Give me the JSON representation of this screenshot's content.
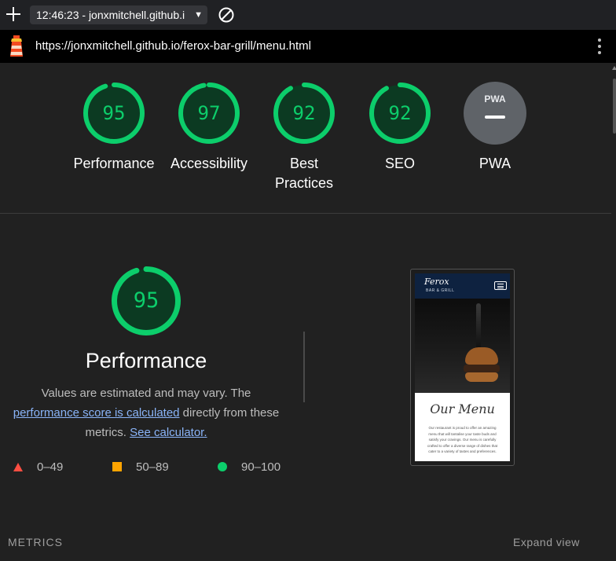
{
  "browser": {
    "tab_title": "12:46:23 - jonxmitchell.github.i",
    "url": "https://jonxmitchell.github.io/ferox-bar-grill/menu.html"
  },
  "scores": [
    {
      "label": "Performance",
      "value": "95",
      "score": 0.95
    },
    {
      "label": "Accessibility",
      "value": "97",
      "score": 0.97
    },
    {
      "label": "Best Practices",
      "value": "92",
      "score": 0.92
    },
    {
      "label": "SEO",
      "value": "92",
      "score": 0.92
    }
  ],
  "pwa": {
    "badge": "PWA",
    "label": "PWA"
  },
  "performance": {
    "score": "95",
    "score_fraction": 0.95,
    "title": "Performance",
    "desc_prefix": "Values are estimated and may vary. The ",
    "desc_link": "performance score is calculated",
    "desc_middle": " directly from these metrics. ",
    "calc_link": "See calculator."
  },
  "legend": [
    {
      "range": "0–49",
      "shape": "triangle",
      "color": "#ff4e42"
    },
    {
      "range": "50–89",
      "shape": "square",
      "color": "#ffa400"
    },
    {
      "range": "90–100",
      "shape": "circle",
      "color": "#0cce6b"
    }
  ],
  "screenshot": {
    "logo": "Ferox",
    "logo_sub": "BAR & GRILL",
    "heading": "Our Menu",
    "text": "Our restaurant is proud to offer an amazing menu that will tantalise your taste buds and satisfy your cravings. Our menu is carefully crafted to offer a diverse range of dishes that cater to a variety of tastes and preferences."
  },
  "footer": {
    "metrics": "METRICS",
    "expand": "Expand view"
  },
  "colors": {
    "pass": "#0cce6b",
    "gauge_track": "#0c3a22",
    "background": "#212121"
  }
}
